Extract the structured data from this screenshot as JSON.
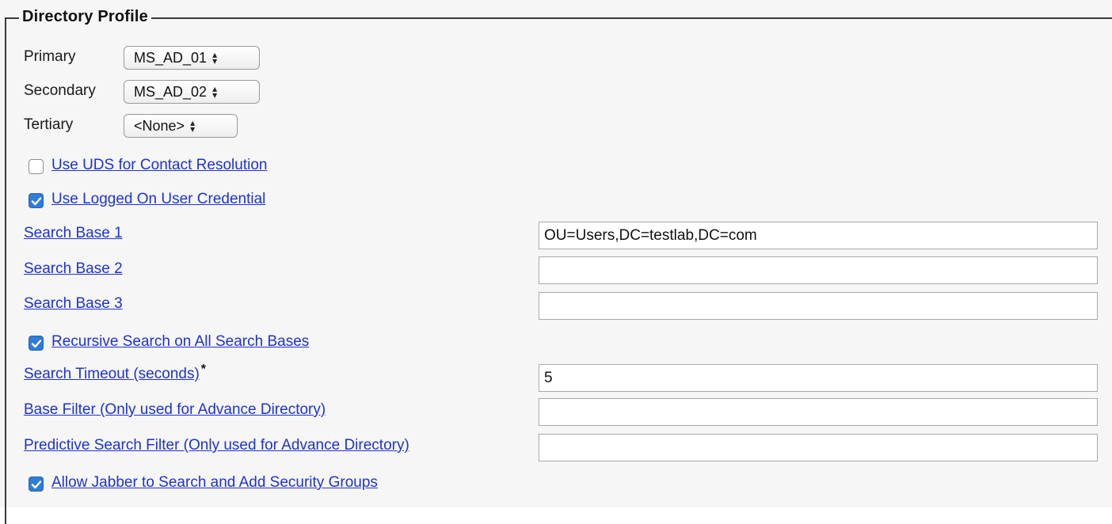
{
  "section": {
    "title": "Directory Profile"
  },
  "servers": [
    {
      "label": "Primary",
      "value": "MS_AD_01"
    },
    {
      "label": "Secondary",
      "value": "MS_AD_02"
    },
    {
      "label": "Tertiary",
      "value": "<None>"
    }
  ],
  "options": {
    "use_uds": {
      "label": "Use UDS for Contact Resolution",
      "checked": false
    },
    "use_logged_on": {
      "label": "Use Logged On User Credential",
      "checked": true
    },
    "recursive": {
      "label": "Recursive Search on All Search Bases",
      "checked": true
    },
    "allow_jabber": {
      "label": "Allow Jabber to Search and Add Security Groups",
      "checked": true
    }
  },
  "fields": {
    "search_base_1": {
      "label": "Search Base 1",
      "value": "OU=Users,DC=testlab,DC=com"
    },
    "search_base_2": {
      "label": "Search Base 2",
      "value": ""
    },
    "search_base_3": {
      "label": "Search Base 3",
      "value": ""
    },
    "search_timeout": {
      "label": "Search Timeout (seconds)",
      "required_marker": "*",
      "value": "5"
    },
    "base_filter": {
      "label": "Base Filter (Only used for Advance Directory)",
      "value": ""
    },
    "predictive_filter": {
      "label": "Predictive Search Filter (Only used for Advance Directory)",
      "value": ""
    }
  },
  "icons": {
    "select_arrows": "up-down-arrows-icon",
    "checkmark": "checkmark-icon"
  },
  "colors": {
    "link": "#1d33cf",
    "checkbox_checked": "#2f7cd9",
    "background": "#f6f6f6"
  }
}
